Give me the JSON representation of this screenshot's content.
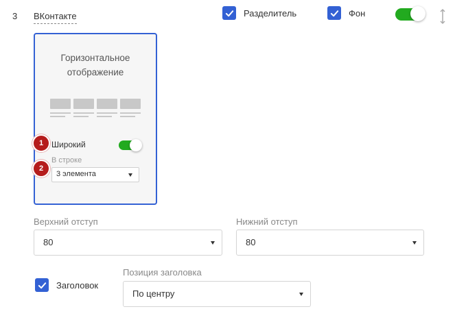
{
  "row": {
    "number": "3",
    "title": "ВКонтакте"
  },
  "header": {
    "divider_label": "Разделитель",
    "divider_checked": true,
    "background_label": "Фон",
    "background_checked": true,
    "enabled_on": true,
    "move_icon": "vertical-arrows-icon"
  },
  "card": {
    "title_line1": "Горизонтальное",
    "title_line2": "отображение",
    "badge1": "1",
    "badge2": "2",
    "wide_label": "Широкий",
    "wide_on": true,
    "per_row_label": "В строке",
    "per_row_value": "3 элемента"
  },
  "padding": {
    "top_label": "Верхний отступ",
    "top_value": "80",
    "bottom_label": "Нижний отступ",
    "bottom_value": "80"
  },
  "heading": {
    "checkbox_label": "Заголовок",
    "checked": true,
    "position_label": "Позиция заголовка",
    "position_value": "По центру"
  },
  "colors": {
    "accent": "#3361d4",
    "toggle_on": "#22aa1f",
    "badge": "#b51c1c"
  }
}
